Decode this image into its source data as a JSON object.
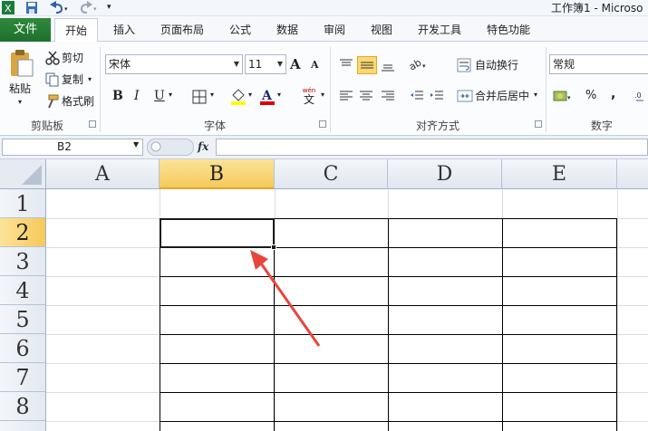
{
  "window": {
    "title": "工作簿1 - Microso"
  },
  "tabs": {
    "file": "文件",
    "home": "开始",
    "insert": "插入",
    "layout": "页面布局",
    "formulas": "公式",
    "data": "数据",
    "review": "审阅",
    "view": "视图",
    "developer": "开发工具",
    "special": "特色功能"
  },
  "clipboard": {
    "paste": "粘贴",
    "cut": "剪切",
    "copy": "复制",
    "format_painter": "格式刷",
    "label": "剪贴板"
  },
  "font": {
    "name": "宋体",
    "size": "11",
    "label": "字体",
    "bold": "B",
    "italic": "I",
    "underline": "U",
    "grow": "A",
    "shrink": "A",
    "phonetic": "wén",
    "phonetic_char": "文"
  },
  "alignment": {
    "wrap": "自动换行",
    "merge": "合并后居中",
    "label": "对齐方式"
  },
  "number": {
    "format": "常规",
    "label": "数字",
    "percent": "%",
    "comma": ","
  },
  "formula_bar": {
    "name_box": "B2",
    "fx": "fx",
    "value": ""
  },
  "grid": {
    "columns": [
      "A",
      "B",
      "C",
      "D",
      "E"
    ],
    "rows": [
      "1",
      "2",
      "3",
      "4",
      "5",
      "6",
      "7",
      "8"
    ],
    "selected_cell": "B2"
  },
  "colors": {
    "file_tab": "#217346",
    "highlight": "#ffff00",
    "font_color": "#e00000",
    "selected_header": "#f6c95a",
    "arrow": "#e8463c"
  }
}
